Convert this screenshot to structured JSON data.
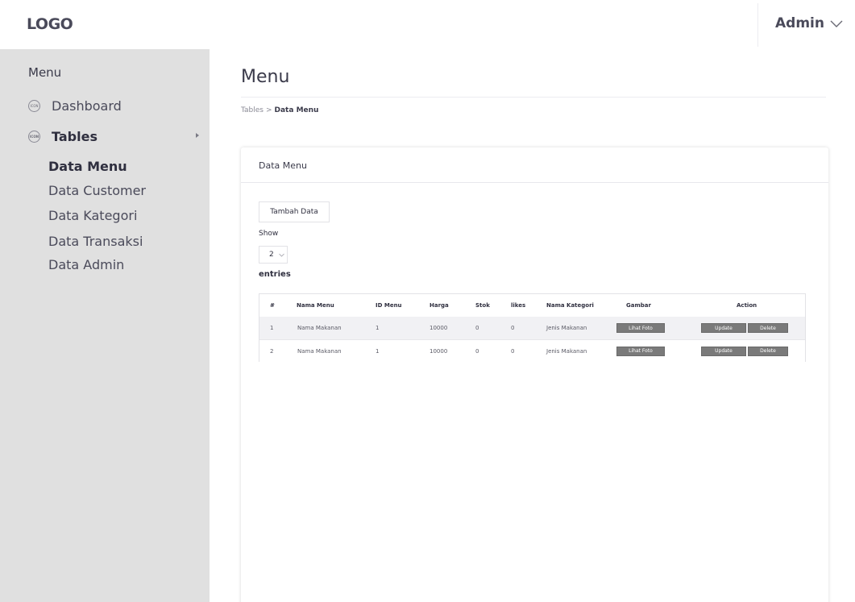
{
  "header": {
    "logo": "LOGO",
    "user_label": "Admin"
  },
  "sidebar": {
    "heading": "Menu",
    "items": [
      {
        "label": "Dashboard",
        "icon_text": "ICON",
        "icon": "circle-icon"
      },
      {
        "label": "Tables",
        "icon_text": "ICON",
        "icon": "circle-icon",
        "expanded": true
      }
    ],
    "subitems": [
      {
        "label": "Data Menu",
        "active": true
      },
      {
        "label": "Data Customer"
      },
      {
        "label": "Data Kategori"
      },
      {
        "label": "Data Transaksi"
      },
      {
        "label": "Data Admin"
      }
    ]
  },
  "page": {
    "title": "Menu",
    "breadcrumb": {
      "parent": "Tables",
      "separator": ">",
      "current": "Data Menu"
    }
  },
  "card": {
    "title": "Data Menu",
    "add_button": "Tambah Data",
    "show_label": "Show",
    "entries_value": "2",
    "entries_label": "entries"
  },
  "table": {
    "columns": [
      "#",
      "Nama Menu",
      "ID Menu",
      "Harga",
      "Stok",
      "likes",
      "Nama Kategori",
      "Gambar",
      "Action"
    ],
    "rows": [
      {
        "no": "1",
        "nama": "Nama Makanan",
        "id": "1",
        "harga": "10000",
        "stok": "0",
        "likes": "0",
        "kategori": "Jenis Makanan",
        "gambar": "Lihat Foto",
        "update": "Update",
        "delete": "Delete"
      },
      {
        "no": "2",
        "nama": "Nama Makanan",
        "id": "1",
        "harga": "10000",
        "stok": "0",
        "likes": "0",
        "kategori": "Jenis Makanan",
        "gambar": "Lihat Foto",
        "update": "Update",
        "delete": "Delete"
      }
    ]
  },
  "colors": {
    "sidebar_bg": "#e0e0e0",
    "text_dark": "#2f2f3f",
    "button_gray": "#7a7a7a",
    "row_stripe": "#f1f1f4"
  }
}
